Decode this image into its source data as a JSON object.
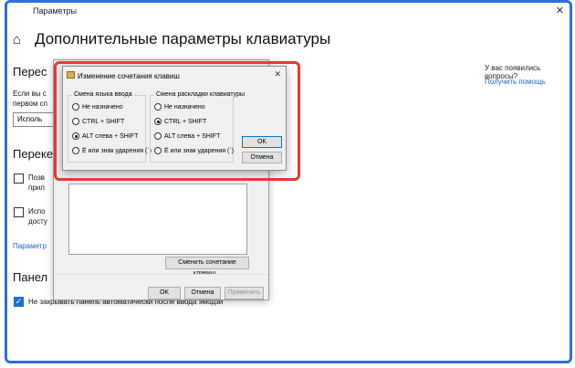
{
  "window": {
    "title": "Параметры",
    "close_glyph": "✕"
  },
  "page": {
    "home_icon": "home-icon",
    "title": "Дополнительные параметры клавиатуры"
  },
  "left": {
    "section1_head": "Перес",
    "section1_text1": "Если вы с",
    "section1_text2": "первом сп",
    "select_value": "Исполь",
    "section2_head": "Переке",
    "check1_line1": "Позв",
    "check1_line2": "прил",
    "check2_line1": "Испо",
    "check2_line2": "досту",
    "link_params": "Параметр",
    "section3_head": "Панел",
    "emoji_checkbox": "Не закрывать панель автоматически после ввода эмодзи"
  },
  "right": {
    "question": "У вас появились вопросы?",
    "help_link": "Получить помощь"
  },
  "bg_dialog": {
    "change_btn": "Сменить сочетание клавиш...",
    "ok": "OK",
    "cancel": "Отмена",
    "apply": "Применить"
  },
  "dialog": {
    "title": "Изменение сочетания клавиш",
    "group1": {
      "legend": "Смена языка ввода",
      "options": [
        "Не назначено",
        "CTRL + SHIFT",
        "ALT слева + SHIFT",
        "Ё или знак ударения (`)"
      ],
      "selected": 2
    },
    "group2": {
      "legend": "Смена раскладки клавиатуры",
      "options": [
        "Не назначено",
        "CTRL + SHIFT",
        "ALT слева + SHIFT",
        "Ё или знак ударения (`)"
      ],
      "selected": 1
    },
    "ok": "OK",
    "cancel": "Отмена"
  },
  "colors": {
    "accent": "#1e64c8",
    "highlight": "#e53935",
    "frame": "#2f6fd6"
  }
}
